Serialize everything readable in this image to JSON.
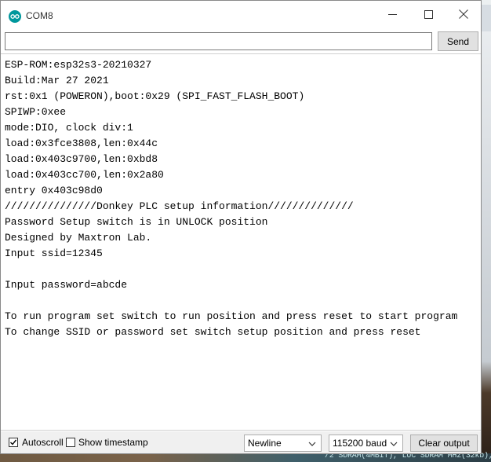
{
  "window": {
    "title": "COM8",
    "icon": "arduino-icon",
    "controls": [
      "minimize-icon",
      "maximize-icon",
      "close-icon"
    ]
  },
  "input": {
    "value": "",
    "placeholder": ""
  },
  "send_label": "Send",
  "output_lines": [
    "ESP-ROM:esp32s3-20210327",
    "Build:Mar 27 2021",
    "rst:0x1 (POWERON),boot:0x29 (SPI_FAST_FLASH_BOOT)",
    "SPIWP:0xee",
    "mode:DIO, clock div:1",
    "load:0x3fce3808,len:0x44c",
    "load:0x403c9700,len:0xbd8",
    "load:0x403cc700,len:0x2a80",
    "entry 0x403c98d0",
    "///////////////Donkey PLC setup information//////////////",
    "Password Setup switch is in UNLOCK position",
    "Designed by Maxtron Lab.",
    "Input ssid=12345",
    "",
    "Input password=abcde",
    "",
    "To run program set switch to run position and press reset to start program",
    "To change SSID or password set switch setup position and press reset"
  ],
  "footer": {
    "autoscroll": {
      "label": "Autoscroll",
      "checked": true
    },
    "timestamp": {
      "label": "Show timestamp",
      "checked": false
    },
    "line_ending": "Newline",
    "baud": "115200 baud",
    "clear_label": "Clear output"
  },
  "background_snippet": "/2 SDRAM(4MBIT), LUC SDRAM MHz(32kb), SPIFFS, SRAM, SDRAM, stable",
  "colors": {
    "accent": "#00979c"
  }
}
